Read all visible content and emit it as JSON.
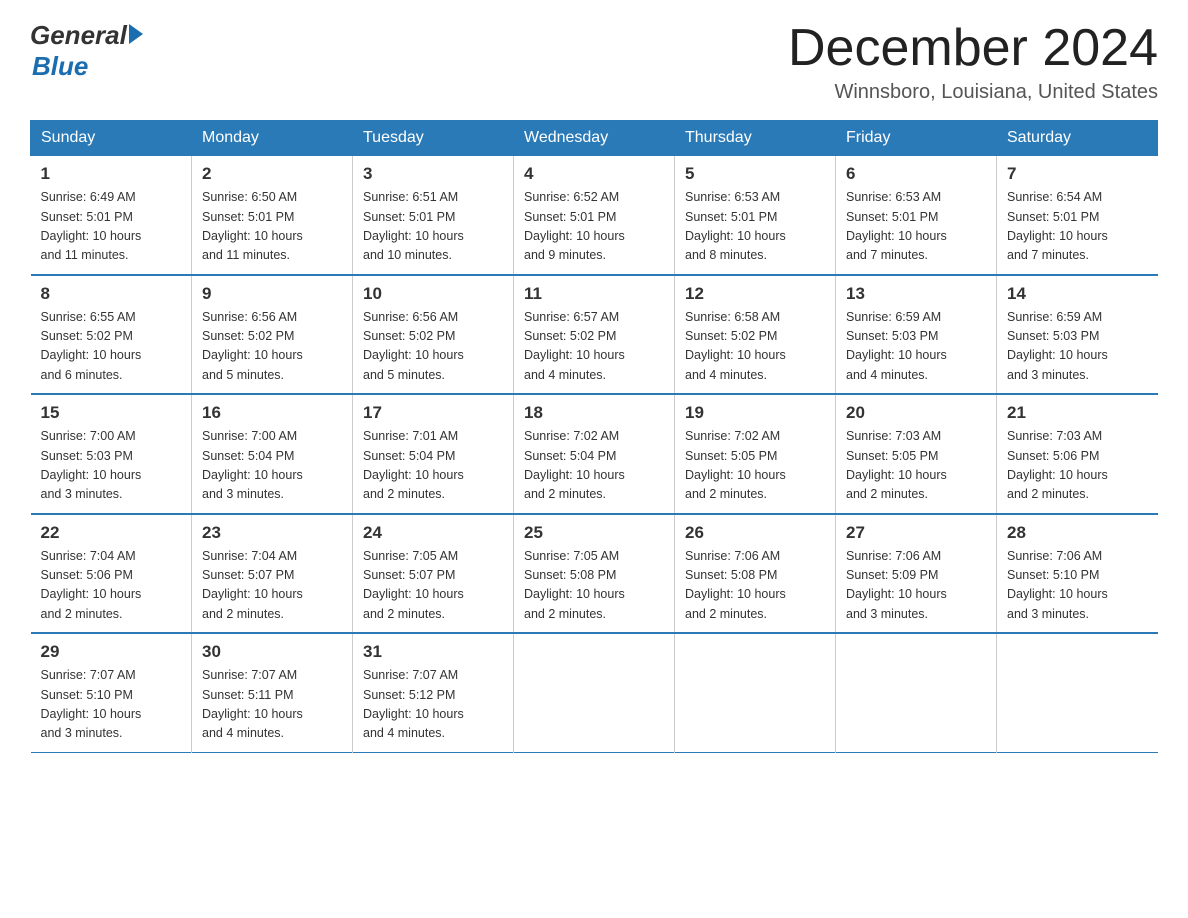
{
  "logo": {
    "general": "General",
    "blue": "Blue"
  },
  "title": "December 2024",
  "location": "Winnsboro, Louisiana, United States",
  "days_of_week": [
    "Sunday",
    "Monday",
    "Tuesday",
    "Wednesday",
    "Thursday",
    "Friday",
    "Saturday"
  ],
  "weeks": [
    [
      {
        "day": "1",
        "info": "Sunrise: 6:49 AM\nSunset: 5:01 PM\nDaylight: 10 hours\nand 11 minutes."
      },
      {
        "day": "2",
        "info": "Sunrise: 6:50 AM\nSunset: 5:01 PM\nDaylight: 10 hours\nand 11 minutes."
      },
      {
        "day": "3",
        "info": "Sunrise: 6:51 AM\nSunset: 5:01 PM\nDaylight: 10 hours\nand 10 minutes."
      },
      {
        "day": "4",
        "info": "Sunrise: 6:52 AM\nSunset: 5:01 PM\nDaylight: 10 hours\nand 9 minutes."
      },
      {
        "day": "5",
        "info": "Sunrise: 6:53 AM\nSunset: 5:01 PM\nDaylight: 10 hours\nand 8 minutes."
      },
      {
        "day": "6",
        "info": "Sunrise: 6:53 AM\nSunset: 5:01 PM\nDaylight: 10 hours\nand 7 minutes."
      },
      {
        "day": "7",
        "info": "Sunrise: 6:54 AM\nSunset: 5:01 PM\nDaylight: 10 hours\nand 7 minutes."
      }
    ],
    [
      {
        "day": "8",
        "info": "Sunrise: 6:55 AM\nSunset: 5:02 PM\nDaylight: 10 hours\nand 6 minutes."
      },
      {
        "day": "9",
        "info": "Sunrise: 6:56 AM\nSunset: 5:02 PM\nDaylight: 10 hours\nand 5 minutes."
      },
      {
        "day": "10",
        "info": "Sunrise: 6:56 AM\nSunset: 5:02 PM\nDaylight: 10 hours\nand 5 minutes."
      },
      {
        "day": "11",
        "info": "Sunrise: 6:57 AM\nSunset: 5:02 PM\nDaylight: 10 hours\nand 4 minutes."
      },
      {
        "day": "12",
        "info": "Sunrise: 6:58 AM\nSunset: 5:02 PM\nDaylight: 10 hours\nand 4 minutes."
      },
      {
        "day": "13",
        "info": "Sunrise: 6:59 AM\nSunset: 5:03 PM\nDaylight: 10 hours\nand 4 minutes."
      },
      {
        "day": "14",
        "info": "Sunrise: 6:59 AM\nSunset: 5:03 PM\nDaylight: 10 hours\nand 3 minutes."
      }
    ],
    [
      {
        "day": "15",
        "info": "Sunrise: 7:00 AM\nSunset: 5:03 PM\nDaylight: 10 hours\nand 3 minutes."
      },
      {
        "day": "16",
        "info": "Sunrise: 7:00 AM\nSunset: 5:04 PM\nDaylight: 10 hours\nand 3 minutes."
      },
      {
        "day": "17",
        "info": "Sunrise: 7:01 AM\nSunset: 5:04 PM\nDaylight: 10 hours\nand 2 minutes."
      },
      {
        "day": "18",
        "info": "Sunrise: 7:02 AM\nSunset: 5:04 PM\nDaylight: 10 hours\nand 2 minutes."
      },
      {
        "day": "19",
        "info": "Sunrise: 7:02 AM\nSunset: 5:05 PM\nDaylight: 10 hours\nand 2 minutes."
      },
      {
        "day": "20",
        "info": "Sunrise: 7:03 AM\nSunset: 5:05 PM\nDaylight: 10 hours\nand 2 minutes."
      },
      {
        "day": "21",
        "info": "Sunrise: 7:03 AM\nSunset: 5:06 PM\nDaylight: 10 hours\nand 2 minutes."
      }
    ],
    [
      {
        "day": "22",
        "info": "Sunrise: 7:04 AM\nSunset: 5:06 PM\nDaylight: 10 hours\nand 2 minutes."
      },
      {
        "day": "23",
        "info": "Sunrise: 7:04 AM\nSunset: 5:07 PM\nDaylight: 10 hours\nand 2 minutes."
      },
      {
        "day": "24",
        "info": "Sunrise: 7:05 AM\nSunset: 5:07 PM\nDaylight: 10 hours\nand 2 minutes."
      },
      {
        "day": "25",
        "info": "Sunrise: 7:05 AM\nSunset: 5:08 PM\nDaylight: 10 hours\nand 2 minutes."
      },
      {
        "day": "26",
        "info": "Sunrise: 7:06 AM\nSunset: 5:08 PM\nDaylight: 10 hours\nand 2 minutes."
      },
      {
        "day": "27",
        "info": "Sunrise: 7:06 AM\nSunset: 5:09 PM\nDaylight: 10 hours\nand 3 minutes."
      },
      {
        "day": "28",
        "info": "Sunrise: 7:06 AM\nSunset: 5:10 PM\nDaylight: 10 hours\nand 3 minutes."
      }
    ],
    [
      {
        "day": "29",
        "info": "Sunrise: 7:07 AM\nSunset: 5:10 PM\nDaylight: 10 hours\nand 3 minutes."
      },
      {
        "day": "30",
        "info": "Sunrise: 7:07 AM\nSunset: 5:11 PM\nDaylight: 10 hours\nand 4 minutes."
      },
      {
        "day": "31",
        "info": "Sunrise: 7:07 AM\nSunset: 5:12 PM\nDaylight: 10 hours\nand 4 minutes."
      },
      {
        "day": "",
        "info": ""
      },
      {
        "day": "",
        "info": ""
      },
      {
        "day": "",
        "info": ""
      },
      {
        "day": "",
        "info": ""
      }
    ]
  ]
}
